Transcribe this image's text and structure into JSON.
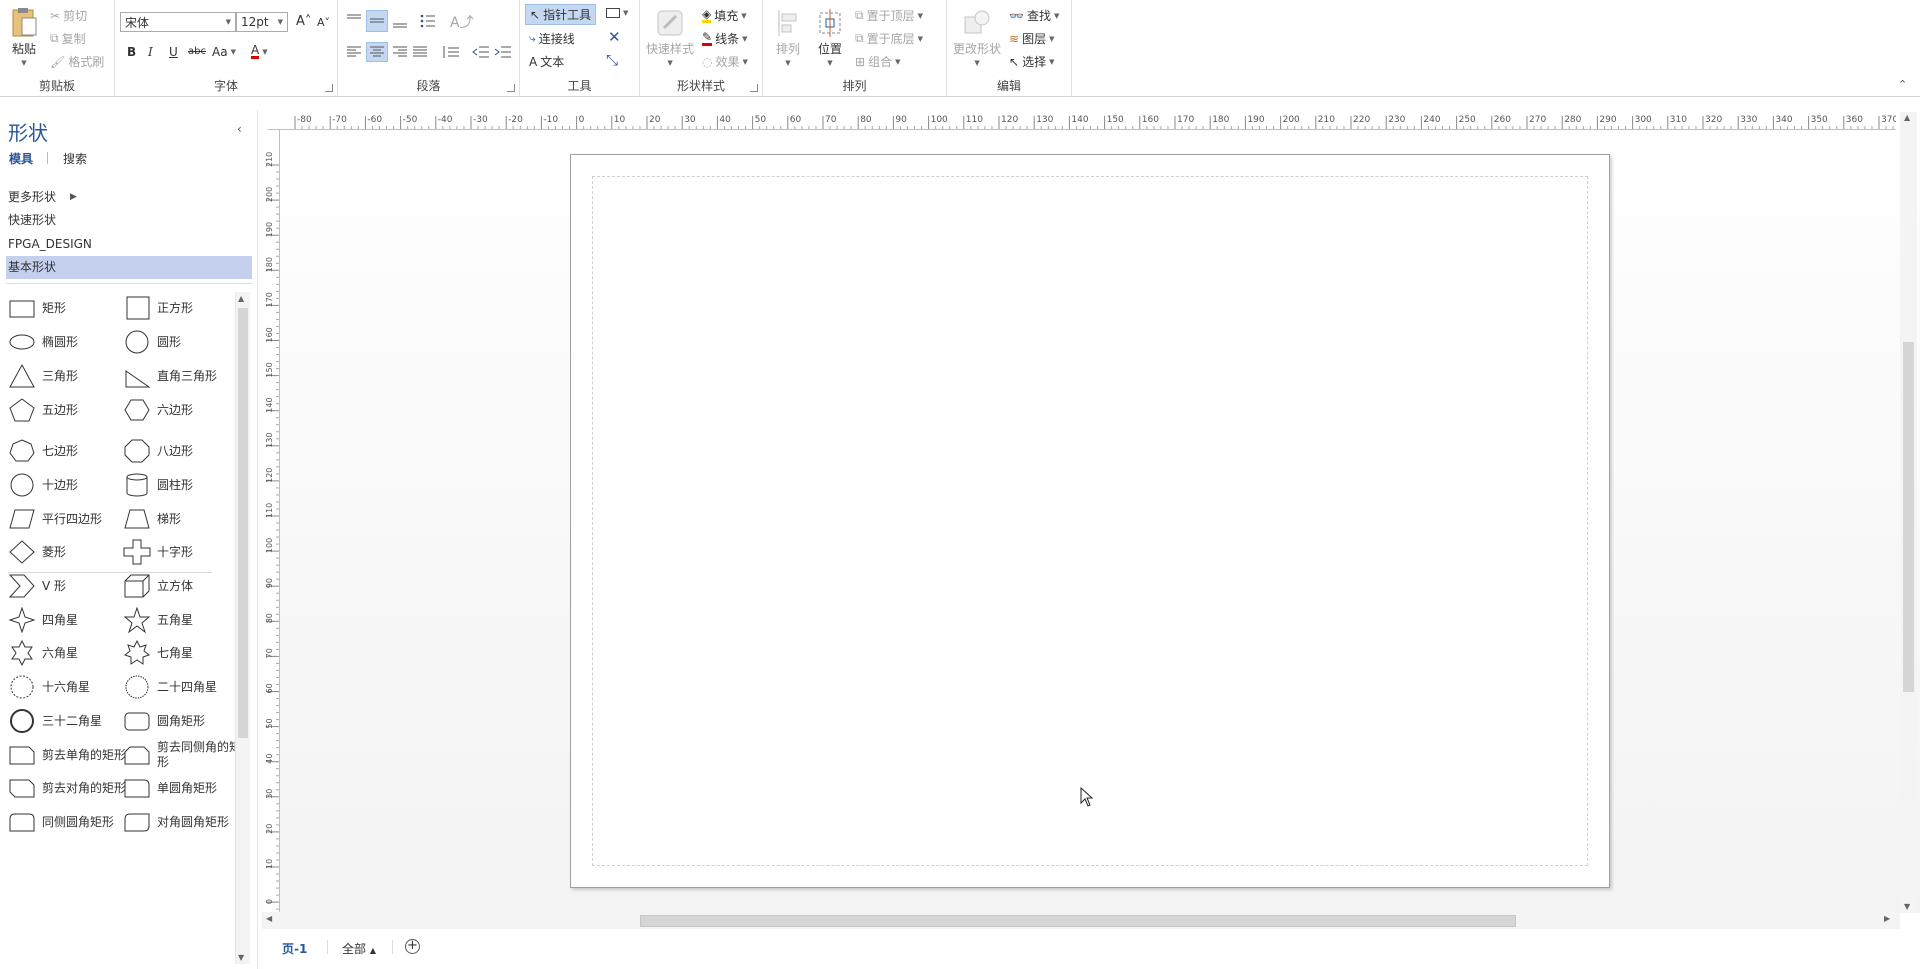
{
  "ribbon": {
    "clipboard": {
      "label": "剪贴板",
      "paste": "粘贴",
      "cut": "剪切",
      "copy": "复制",
      "format_painter": "格式刷"
    },
    "font": {
      "label": "字体",
      "font_name": "宋体",
      "font_size": "12pt",
      "bold": "B",
      "italic": "I",
      "underline": "U",
      "strike": "abc",
      "case": "Aa",
      "color_letter": "A"
    },
    "paragraph": {
      "label": "段落"
    },
    "tools": {
      "label": "工具",
      "pointer": "指针工具",
      "connector": "连接线",
      "text": "文本"
    },
    "shape_styles": {
      "label": "形状样式",
      "quick_styles": "快速样式",
      "fill": "填充",
      "line": "线条",
      "effects": "效果"
    },
    "arrange": {
      "label": "排列",
      "align": "排列",
      "position": "位置",
      "bring_front": "置于顶层",
      "send_back": "置于底层",
      "group": "组合"
    },
    "editing": {
      "label": "编辑",
      "change_shape": "更改形状",
      "find": "查找",
      "layers": "图层",
      "select": "选择"
    }
  },
  "pane": {
    "title": "形状",
    "tabs": [
      "模具",
      "搜索"
    ],
    "stencils": [
      "更多形状",
      "快速形状",
      "FPGA_DESIGN",
      "基本形状"
    ],
    "active_stencil_index": 3,
    "shapes": [
      "矩形",
      "正方形",
      "椭圆形",
      "圆形",
      "三角形",
      "直角三角形",
      "五边形",
      "六边形",
      "七边形",
      "八边形",
      "十边形",
      "圆柱形",
      "平行四边形",
      "梯形",
      "菱形",
      "十字形",
      "V 形",
      "立方体",
      "四角星",
      "五角星",
      "六角星",
      "七角星",
      "十六角星",
      "二十四角星",
      "三十二角星",
      "圆角矩形",
      "剪去单角的矩形",
      "剪去同侧角的矩形",
      "剪去对角的矩形",
      "单圆角矩形",
      "同侧圆角矩形",
      "对角圆角矩形"
    ]
  },
  "rulers": {
    "h_ticks": [
      "-80",
      "-70",
      "-60",
      "-50",
      "-40",
      "-30",
      "-20",
      "-10",
      "0",
      "10",
      "20",
      "30",
      "40",
      "50",
      "60",
      "70",
      "80",
      "90",
      "100",
      "110",
      "120",
      "130",
      "140",
      "150",
      "160",
      "170",
      "180",
      "190",
      "200",
      "210",
      "220",
      "230",
      "240",
      "250",
      "260",
      "270",
      "280",
      "290",
      "300",
      "310",
      "320",
      "330",
      "340",
      "350",
      "360",
      "370"
    ],
    "v_ticks": [
      "210",
      "200",
      "190",
      "180",
      "170",
      "160",
      "150",
      "140",
      "130",
      "120",
      "110",
      "100",
      "90",
      "80",
      "70",
      "60",
      "50",
      "40",
      "30",
      "20",
      "10",
      "0"
    ]
  },
  "page_tabs": {
    "current": "页-1",
    "all": "全部"
  }
}
